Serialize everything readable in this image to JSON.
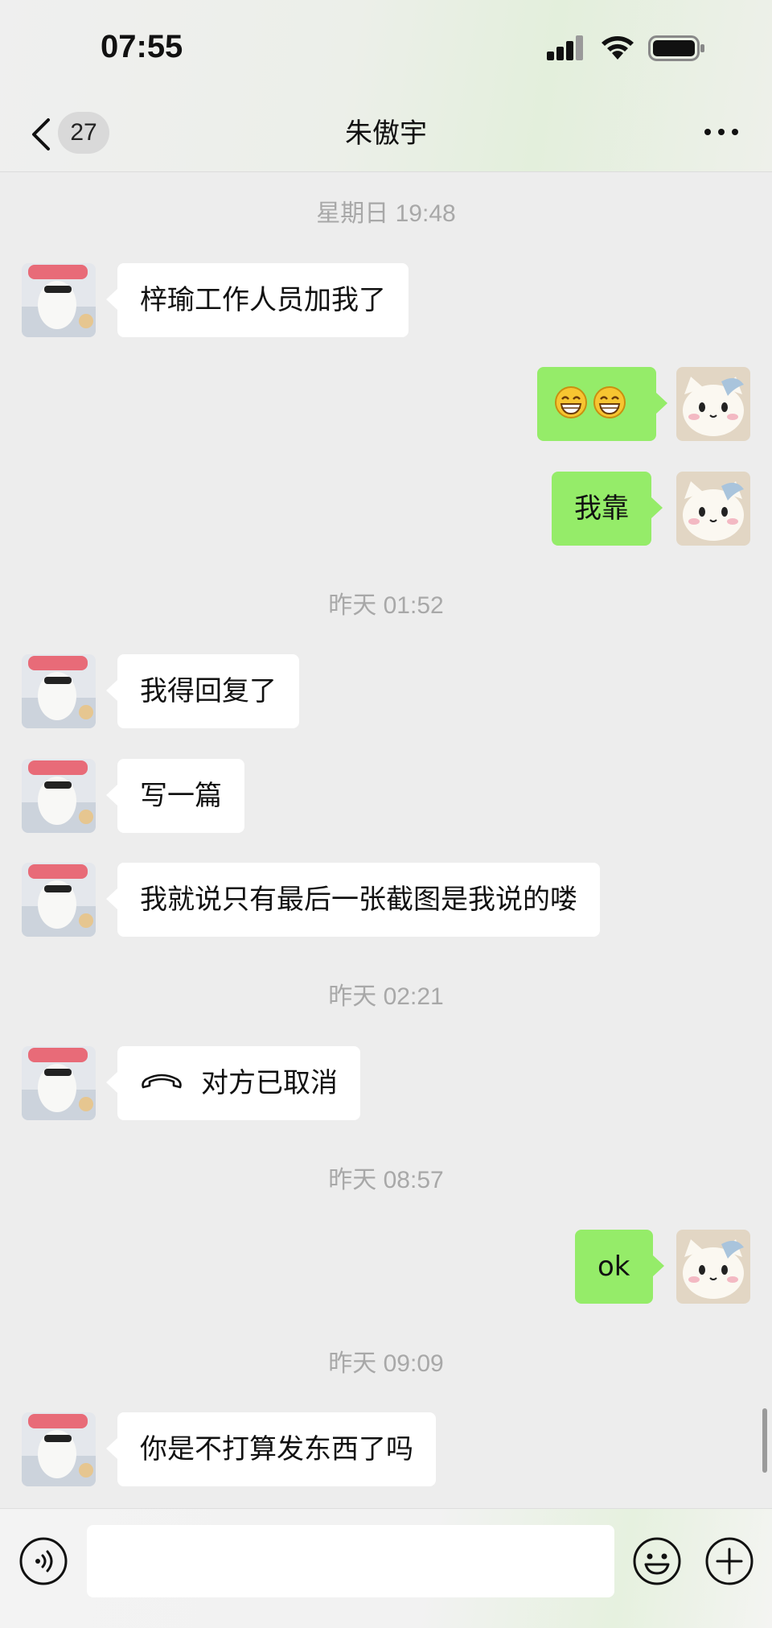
{
  "status_bar": {
    "time": "07:55"
  },
  "header": {
    "unread_count": "27",
    "title": "朱傲宇"
  },
  "messages": [
    {
      "type": "time",
      "text": "星期日 19:48"
    },
    {
      "type": "in",
      "text": "梓瑜工作人员加我了"
    },
    {
      "type": "out",
      "content": "emoji",
      "emojis": [
        "grin-emoji",
        "grin-emoji"
      ]
    },
    {
      "type": "out",
      "text": "我靠"
    },
    {
      "type": "time",
      "text": "昨天 01:52"
    },
    {
      "type": "in",
      "text": "我得回复了"
    },
    {
      "type": "in",
      "text": "写一篇"
    },
    {
      "type": "in",
      "text": "我就说只有最后一张截图是我说的喽"
    },
    {
      "type": "time",
      "text": "昨天 02:21"
    },
    {
      "type": "in",
      "text": "对方已取消",
      "icon": "phone-hangup-icon"
    },
    {
      "type": "time",
      "text": "昨天 08:57"
    },
    {
      "type": "out",
      "text": "ok"
    },
    {
      "type": "time",
      "text": "昨天 09:09"
    },
    {
      "type": "in",
      "text": "你是不打算发东西了吗"
    }
  ],
  "input_bar": {
    "input_value": "",
    "placeholder": ""
  },
  "colors": {
    "background": "#ededed",
    "incoming_bubble": "#ffffff",
    "outgoing_bubble": "#95ec69",
    "timestamp_text": "#a8a8a8"
  }
}
